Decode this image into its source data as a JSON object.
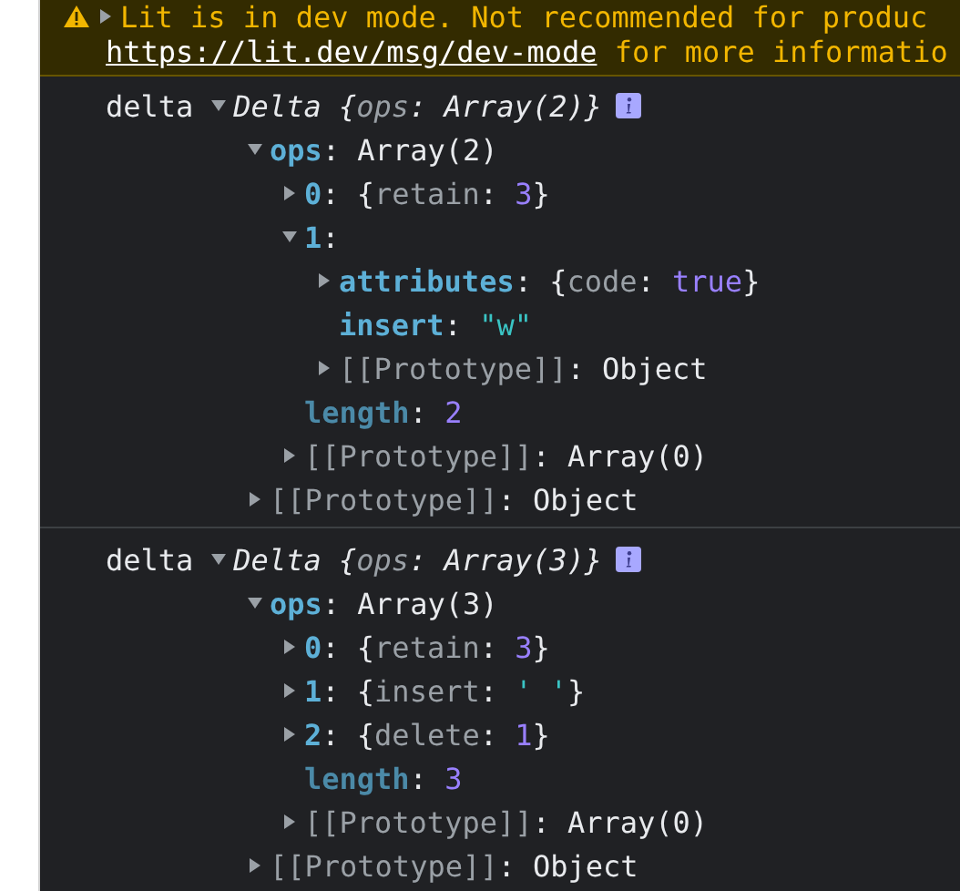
{
  "warning": {
    "expanded": false,
    "message": "Lit is in dev mode. Not recommended for produc",
    "link": "https://lit.dev/msg/dev-mode",
    "suffix": " for more informatio"
  },
  "logs": [
    {
      "label": "delta",
      "tree": {
        "kind": "expandable",
        "expanded": true,
        "info": true,
        "tokens": [
          {
            "kind": "class",
            "text": "Delta {"
          },
          {
            "kind": "preview-key",
            "text": "ops"
          },
          {
            "kind": "class",
            "text": ": Array(2)}"
          }
        ],
        "children": [
          {
            "kind": "expandable",
            "expanded": true,
            "tokens": [
              {
                "kind": "key",
                "text": "ops"
              },
              {
                "kind": "punct",
                "text": ": Array(2)"
              }
            ],
            "children": [
              {
                "kind": "expandable",
                "expanded": false,
                "tokens": [
                  {
                    "kind": "key",
                    "text": "0"
                  },
                  {
                    "kind": "punct",
                    "text": ": {"
                  },
                  {
                    "kind": "text-dim",
                    "text": "retain"
                  },
                  {
                    "kind": "punct",
                    "text": ": "
                  },
                  {
                    "kind": "number",
                    "text": "3"
                  },
                  {
                    "kind": "punct",
                    "text": "}"
                  }
                ]
              },
              {
                "kind": "expandable",
                "expanded": true,
                "tokens": [
                  {
                    "kind": "key",
                    "text": "1"
                  },
                  {
                    "kind": "punct",
                    "text": ":"
                  }
                ],
                "children": [
                  {
                    "kind": "expandable",
                    "expanded": false,
                    "tokens": [
                      {
                        "kind": "key",
                        "text": "attributes"
                      },
                      {
                        "kind": "punct",
                        "text": ": {"
                      },
                      {
                        "kind": "text-dim",
                        "text": "code"
                      },
                      {
                        "kind": "punct",
                        "text": ": "
                      },
                      {
                        "kind": "number",
                        "text": "true"
                      },
                      {
                        "kind": "punct",
                        "text": "}"
                      }
                    ]
                  },
                  {
                    "kind": "leaf",
                    "tokens": [
                      {
                        "kind": "key",
                        "text": "insert"
                      },
                      {
                        "kind": "punct",
                        "text": ": "
                      },
                      {
                        "kind": "string",
                        "text": "\"w\""
                      }
                    ]
                  },
                  {
                    "kind": "expandable",
                    "expanded": false,
                    "tokens": [
                      {
                        "kind": "text-dim",
                        "text": "[[Prototype]]"
                      },
                      {
                        "kind": "punct",
                        "text": ": Object"
                      }
                    ]
                  }
                ]
              },
              {
                "kind": "leaf",
                "tokens": [
                  {
                    "kind": "key-dim",
                    "text": "length"
                  },
                  {
                    "kind": "punct",
                    "text": ": "
                  },
                  {
                    "kind": "number",
                    "text": "2"
                  }
                ]
              },
              {
                "kind": "expandable",
                "expanded": false,
                "tokens": [
                  {
                    "kind": "text-dim",
                    "text": "[[Prototype]]"
                  },
                  {
                    "kind": "punct",
                    "text": ": Array(0)"
                  }
                ]
              }
            ]
          },
          {
            "kind": "expandable",
            "expanded": false,
            "tokens": [
              {
                "kind": "text-dim",
                "text": "[[Prototype]]"
              },
              {
                "kind": "punct",
                "text": ": Object"
              }
            ]
          }
        ]
      }
    },
    {
      "label": "delta",
      "tree": {
        "kind": "expandable",
        "expanded": true,
        "info": true,
        "tokens": [
          {
            "kind": "class",
            "text": "Delta {"
          },
          {
            "kind": "preview-key",
            "text": "ops"
          },
          {
            "kind": "class",
            "text": ": Array(3)}"
          }
        ],
        "children": [
          {
            "kind": "expandable",
            "expanded": true,
            "tokens": [
              {
                "kind": "key",
                "text": "ops"
              },
              {
                "kind": "punct",
                "text": ": Array(3)"
              }
            ],
            "children": [
              {
                "kind": "expandable",
                "expanded": false,
                "tokens": [
                  {
                    "kind": "key",
                    "text": "0"
                  },
                  {
                    "kind": "punct",
                    "text": ": {"
                  },
                  {
                    "kind": "text-dim",
                    "text": "retain"
                  },
                  {
                    "kind": "punct",
                    "text": ": "
                  },
                  {
                    "kind": "number",
                    "text": "3"
                  },
                  {
                    "kind": "punct",
                    "text": "}"
                  }
                ]
              },
              {
                "kind": "expandable",
                "expanded": false,
                "tokens": [
                  {
                    "kind": "key",
                    "text": "1"
                  },
                  {
                    "kind": "punct",
                    "text": ": {"
                  },
                  {
                    "kind": "text-dim",
                    "text": "insert"
                  },
                  {
                    "kind": "punct",
                    "text": ": "
                  },
                  {
                    "kind": "string",
                    "text": "' '"
                  },
                  {
                    "kind": "punct",
                    "text": "}"
                  }
                ]
              },
              {
                "kind": "expandable",
                "expanded": false,
                "tokens": [
                  {
                    "kind": "key",
                    "text": "2"
                  },
                  {
                    "kind": "punct",
                    "text": ": {"
                  },
                  {
                    "kind": "text-dim",
                    "text": "delete"
                  },
                  {
                    "kind": "punct",
                    "text": ": "
                  },
                  {
                    "kind": "number",
                    "text": "1"
                  },
                  {
                    "kind": "punct",
                    "text": "}"
                  }
                ]
              },
              {
                "kind": "leaf",
                "tokens": [
                  {
                    "kind": "key-dim",
                    "text": "length"
                  },
                  {
                    "kind": "punct",
                    "text": ": "
                  },
                  {
                    "kind": "number",
                    "text": "3"
                  }
                ]
              },
              {
                "kind": "expandable",
                "expanded": false,
                "tokens": [
                  {
                    "kind": "text-dim",
                    "text": "[[Prototype]]"
                  },
                  {
                    "kind": "punct",
                    "text": ": Array(0)"
                  }
                ]
              }
            ]
          },
          {
            "kind": "expandable",
            "expanded": false,
            "tokens": [
              {
                "kind": "text-dim",
                "text": "[[Prototype]]"
              },
              {
                "kind": "punct",
                "text": ": Object"
              }
            ]
          }
        ]
      }
    }
  ]
}
